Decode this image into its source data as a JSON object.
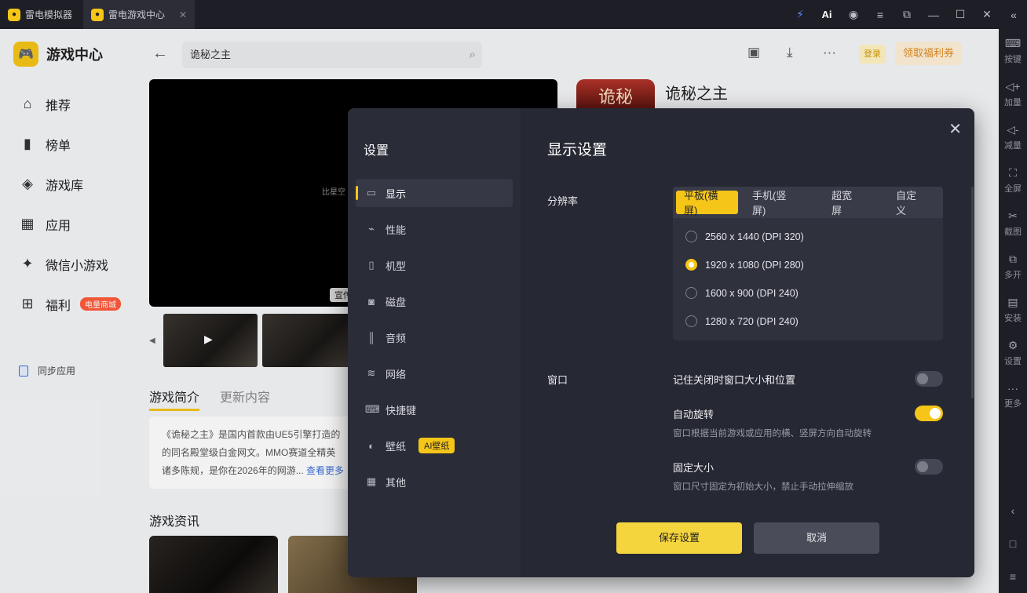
{
  "titlebar": {
    "tabs": [
      {
        "label": "雷电模拟器"
      },
      {
        "label": "雷电游戏中心"
      }
    ]
  },
  "rightbar": {
    "items": [
      {
        "label": "按键",
        "icon": "keyboard-icon"
      },
      {
        "label": "加量",
        "icon": "volume-up-icon"
      },
      {
        "label": "减量",
        "icon": "volume-down-icon"
      },
      {
        "label": "全屏",
        "icon": "fullscreen-icon"
      },
      {
        "label": "截图",
        "icon": "scissors-icon"
      },
      {
        "label": "多开",
        "icon": "multi-instance-icon"
      },
      {
        "label": "安装",
        "icon": "apk-install-icon"
      },
      {
        "label": "设置",
        "icon": "gear-icon"
      },
      {
        "label": "更多",
        "icon": "more-icon"
      }
    ]
  },
  "sidebar": {
    "brand": "游戏中心",
    "items": [
      {
        "label": "推荐",
        "icon": "home-icon"
      },
      {
        "label": "榜单",
        "icon": "rank-icon"
      },
      {
        "label": "游戏库",
        "icon": "gamepad-icon"
      },
      {
        "label": "应用",
        "icon": "apps-icon"
      },
      {
        "label": "微信小游戏",
        "icon": "wechat-game-icon"
      },
      {
        "label": "福利",
        "icon": "gift-icon",
        "badge": "电量商城"
      }
    ],
    "sync_label": "同步应用"
  },
  "main": {
    "search_value": "诡秘之主",
    "login_label": "登录",
    "welfare_label": "领取福利券",
    "video_text": "比星空",
    "video_tag": "宣传片",
    "game_title": "诡秘之主",
    "game_icon_text": "诡秘",
    "tabs": [
      "游戏简介",
      "更新内容"
    ],
    "intro_line1": "《诡秘之主》是国内首款由UE5引擎打造的",
    "intro_line2": "的同名殿堂级白金网文。MMO赛道全精英",
    "intro_line3": "诸多陈规，是你在2026年的网游...",
    "intro_more": "查看更多",
    "news_title": "游戏资讯"
  },
  "dialog": {
    "side_title": "设置",
    "nav": [
      {
        "label": "显示",
        "icon": "monitor-icon"
      },
      {
        "label": "性能",
        "icon": "performance-icon"
      },
      {
        "label": "机型",
        "icon": "phone-icon"
      },
      {
        "label": "磁盘",
        "icon": "disk-icon"
      },
      {
        "label": "音频",
        "icon": "audio-icon"
      },
      {
        "label": "网络",
        "icon": "wifi-icon"
      },
      {
        "label": "快捷键",
        "icon": "keyboard-icon"
      },
      {
        "label": "壁纸",
        "icon": "palette-icon",
        "badge": "AI壁纸"
      },
      {
        "label": "其他",
        "icon": "grid-icon"
      }
    ],
    "title": "显示设置",
    "resolution_label": "分辨率",
    "segments": [
      "平板(横屏)",
      "手机(竖屏)",
      "超宽屏",
      "自定义"
    ],
    "resolutions": [
      "2560 x 1440  (DPI 320)",
      "1920 x 1080  (DPI 280)",
      "1600 x 900  (DPI 240)",
      "1280 x 720  (DPI 240)"
    ],
    "window_label": "窗口",
    "options": [
      {
        "title": "记住关闭时窗口大小和位置",
        "desc": "",
        "on": false
      },
      {
        "title": "自动旋转",
        "desc": "窗口根据当前游戏或应用的横、竖屏方向自动旋转",
        "on": true
      },
      {
        "title": "固定大小",
        "desc": "窗口尺寸固定为初始大小，禁止手动拉伸缩放",
        "on": false
      }
    ],
    "save_label": "保存设置",
    "cancel_label": "取消"
  }
}
